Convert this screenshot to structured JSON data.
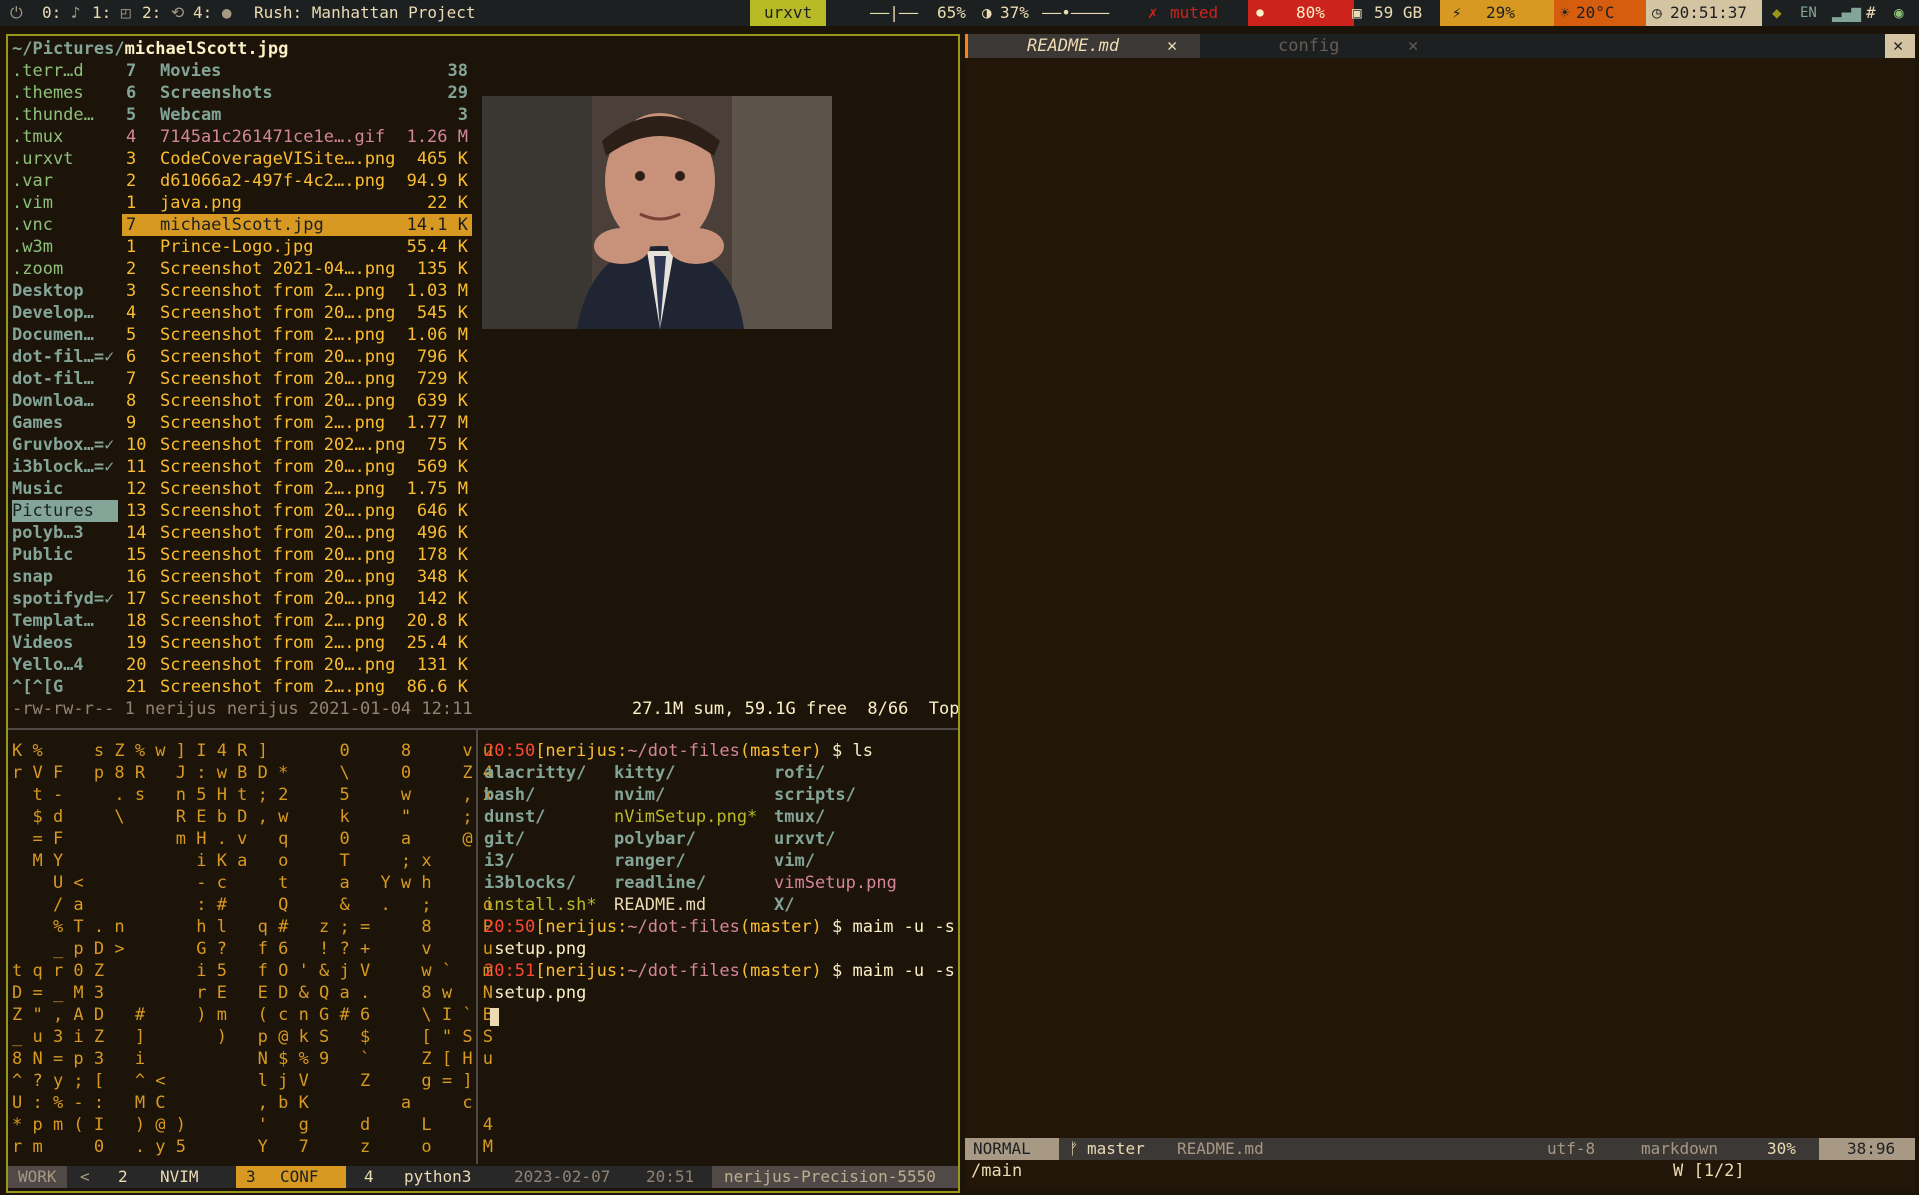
{
  "topbar": {
    "ws": [
      {
        "num": "0:",
        "icon": "♪"
      },
      {
        "num": "1:",
        "icon": "◰"
      },
      {
        "num": "2:",
        "icon": "⟲"
      },
      {
        "num": "4:",
        "icon": "●"
      }
    ],
    "music": "Rush: Manhattan Project",
    "window_title": "urxvt",
    "volume_bar": "——|——",
    "volume_pct": "65%",
    "brightness_pct": "37%",
    "brightness_bar": "——•————",
    "muted": "muted",
    "mic_pct": "80%",
    "disk": "59 GB",
    "battery": "29%",
    "temp": "20°C",
    "clock": "20:51:37",
    "lang": "EN"
  },
  "ranger": {
    "path_dir": "~/Pictures/",
    "path_file": "michaelScott.jpg",
    "parent_dirs": [
      ".terr…d",
      ".themes",
      ".thunde…",
      ".tmux",
      ".urxvt",
      ".var",
      ".vim",
      ".vnc",
      ".w3m",
      ".zoom",
      "Desktop",
      "Develop…",
      "Documen…",
      "dot-fil…=✓",
      "dot-fil…",
      "Downloa…",
      "Games",
      "Gruvbox…=✓",
      "i3block…=✓",
      "Music",
      "Pictures",
      "polyb…3",
      "Public",
      "snap",
      "spotifyd=✓",
      "Templat…",
      "Videos",
      "Yello…4",
      "^[^[G"
    ],
    "files": [
      {
        "n": "7",
        "name": "Movies",
        "size": "38",
        "dir": true
      },
      {
        "n": "6",
        "name": "Screenshots",
        "size": "29",
        "dir": true
      },
      {
        "n": "5",
        "name": "Webcam",
        "size": "3",
        "dir": true
      },
      {
        "n": "4",
        "name": "7145a1c261471ce1e….gif",
        "size": "1.26 M"
      },
      {
        "n": "3",
        "name": "CodeCoverageVISite….png",
        "size": "465 K"
      },
      {
        "n": "2",
        "name": "d61066a2-497f-4c2….png",
        "size": "94.9 K"
      },
      {
        "n": "1",
        "name": "java.png",
        "size": "22 K"
      },
      {
        "n": "7",
        "name": "michaelScott.jpg",
        "size": "14.1 K",
        "selected": true
      },
      {
        "n": "1",
        "name": "Prince-Logo.jpg",
        "size": "55.4 K"
      },
      {
        "n": "2",
        "name": "Screenshot 2021-04….png",
        "size": "135 K"
      },
      {
        "n": "3",
        "name": "Screenshot from 2….png",
        "size": "1.03 M"
      },
      {
        "n": "4",
        "name": "Screenshot from 20….png",
        "size": "545 K"
      },
      {
        "n": "5",
        "name": "Screenshot from 2….png",
        "size": "1.06 M"
      },
      {
        "n": "6",
        "name": "Screenshot from 20….png",
        "size": "796 K"
      },
      {
        "n": "7",
        "name": "Screenshot from 20….png",
        "size": "729 K"
      },
      {
        "n": "8",
        "name": "Screenshot from 20….png",
        "size": "639 K"
      },
      {
        "n": "9",
        "name": "Screenshot from 2….png",
        "size": "1.77 M"
      },
      {
        "n": "10",
        "name": "Screenshot from 202….png",
        "size": "75 K"
      },
      {
        "n": "11",
        "name": "Screenshot from 20….png",
        "size": "569 K"
      },
      {
        "n": "12",
        "name": "Screenshot from 2….png",
        "size": "1.75 M"
      },
      {
        "n": "13",
        "name": "Screenshot from 20….png",
        "size": "646 K"
      },
      {
        "n": "14",
        "name": "Screenshot from 20….png",
        "size": "496 K"
      },
      {
        "n": "15",
        "name": "Screenshot from 20….png",
        "size": "178 K"
      },
      {
        "n": "16",
        "name": "Screenshot from 20….png",
        "size": "348 K"
      },
      {
        "n": "17",
        "name": "Screenshot from 20….png",
        "size": "142 K"
      },
      {
        "n": "18",
        "name": "Screenshot from 2….png",
        "size": "20.8 K"
      },
      {
        "n": "19",
        "name": "Screenshot from 2….png",
        "size": "25.4 K"
      },
      {
        "n": "20",
        "name": "Screenshot from 20….png",
        "size": "131 K"
      },
      {
        "n": "21",
        "name": "Screenshot from 2….png",
        "size": "86.6 K"
      }
    ],
    "status_left": "-rw-rw-r-- 1 nerijus nerijus 2021-01-04 12:11",
    "status_right": "27.1M sum, 59.1G free  8/66  Top"
  },
  "matrix_lines": [
    "K %     s Z % w ] I 4 R ]       0     8     v u",
    "r V F   p 8 R   J : w B D *     \\     0     Z 4",
    "  t -     . s   n 5 H t ; 2     5     w     , x",
    "  $ d     \\     R E b D , w     k     \"     ;  ",
    "  = F           m H . v   q     0     a     @  ",
    "  M Y             i K a   o     T     ; x      ",
    "    U <           - c     t     a   Y w h      ",
    "    / a           : #     Q     &   .   ;     o",
    "    % T . n       h l   q #   z ; =     8     P",
    "    _ p D >       G ?   f 6   ! ? +     v     u",
    "t q r 0 Z         i 5   f O ' & j V     w `   m",
    "D = _ M 3         r E   E D & Q a .     8 w   N",
    "Z \" , A D   #     ) m   ( c n G # 6     \\ I ` B",
    "_ u 3 i Z   ]       )   p @ k S   $     [ \" S S",
    "8 N = p 3   i           N $ % 9   `     Z [ H u",
    "^ ? y ; [   ^ <         l j V     Z     g = ]  ",
    "U : % - :   M C         , b K         a     c  ",
    "* p m ( I   ) @ )       '   g     d     L     4",
    "r m     0   . y 5       Y   7     z     o     M"
  ],
  "shell": {
    "time1": "20:50",
    "time2": "20:51",
    "user_host": "[nerijus:",
    "cwd": "~/dot-files",
    "branch": "(master)",
    "cmd_ls": " $ ls",
    "cmd_maim": " $ maim -u -s",
    "arg_cont": " setup.png",
    "ls_cols": [
      [
        "alacritty/",
        "bash/",
        "dunst/",
        "git/",
        "i3/",
        "i3blocks/",
        "install.sh*"
      ],
      [
        "kitty/",
        "nvim/",
        "nVimSetup.png*",
        "polybar/",
        "ranger/",
        "readline/",
        "README.md"
      ],
      [
        "rofi/",
        "scripts/",
        "tmux/",
        "urxvt/",
        "vim/",
        "vimSetup.png",
        "X/"
      ]
    ]
  },
  "tmux_bar": {
    "session": "WORK",
    "sep": "<",
    "w2_num": "2",
    "w2_name": "NVIM",
    "w3_num": "3",
    "w3_name": "CONF",
    "w4_num": "4",
    "w4_name": "python3",
    "date": "2023-02-07",
    "time": "20:51",
    "host": "nerijus-Precision-5550"
  },
  "nvim": {
    "tab1": "README.md",
    "tab2": "config",
    "close": "✕",
    "mode": "NORMAL",
    "branch": "master",
    "file": "README.md",
    "encoding": "utf-8",
    "filetype": "markdown",
    "percent": "30%",
    "pos": "38:96",
    "cmdline": "/main",
    "search_count": "W [1/2]"
  }
}
